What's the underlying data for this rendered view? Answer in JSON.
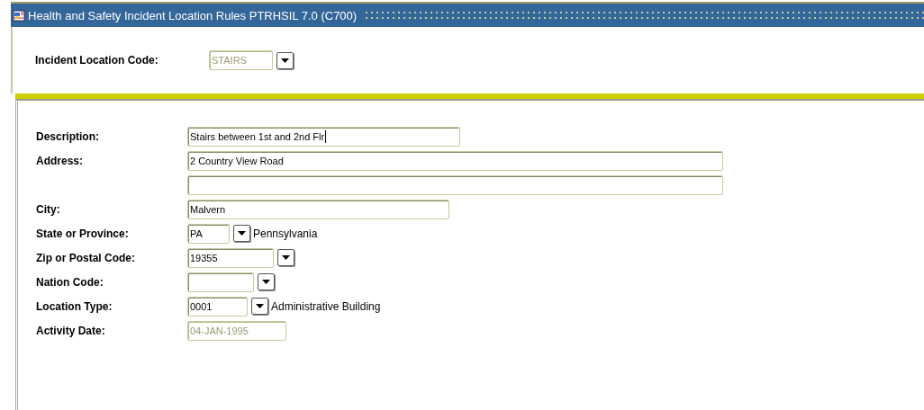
{
  "window": {
    "title": "Health and Safety Incident Location Rules  PTRHSIL  7.0  (C700)"
  },
  "key_block": {
    "label": "Incident Location Code:",
    "value": "STAIRS",
    "disabled": true,
    "lookup": true
  },
  "fields": [
    {
      "label": "Description:",
      "value": "Stairs between 1st and 2nd Flr",
      "disabled": false,
      "focused": true
    },
    {
      "label": "Address:",
      "value": "2 Country View Road",
      "disabled": false
    },
    {
      "disabled": false
    },
    {
      "label": "City:",
      "value": "Malvern",
      "disabled": false
    },
    {
      "label": "State or Province:",
      "value": "PA",
      "disabled": false,
      "lookup": true,
      "note": "Pennsylvania"
    },
    {
      "label": "Zip or Postal Code:",
      "value": "19355",
      "disabled": false,
      "lookup": true
    },
    {
      "disabled": false,
      "label": "Nation Code:",
      "lookup": true
    },
    {
      "label": "Location Type:",
      "value": "0001",
      "disabled": false,
      "lookup": true,
      "note": "Administrative Building"
    },
    {
      "label": "Activity Date:",
      "value": "04-JAN-1995",
      "disabled": true
    }
  ]
}
